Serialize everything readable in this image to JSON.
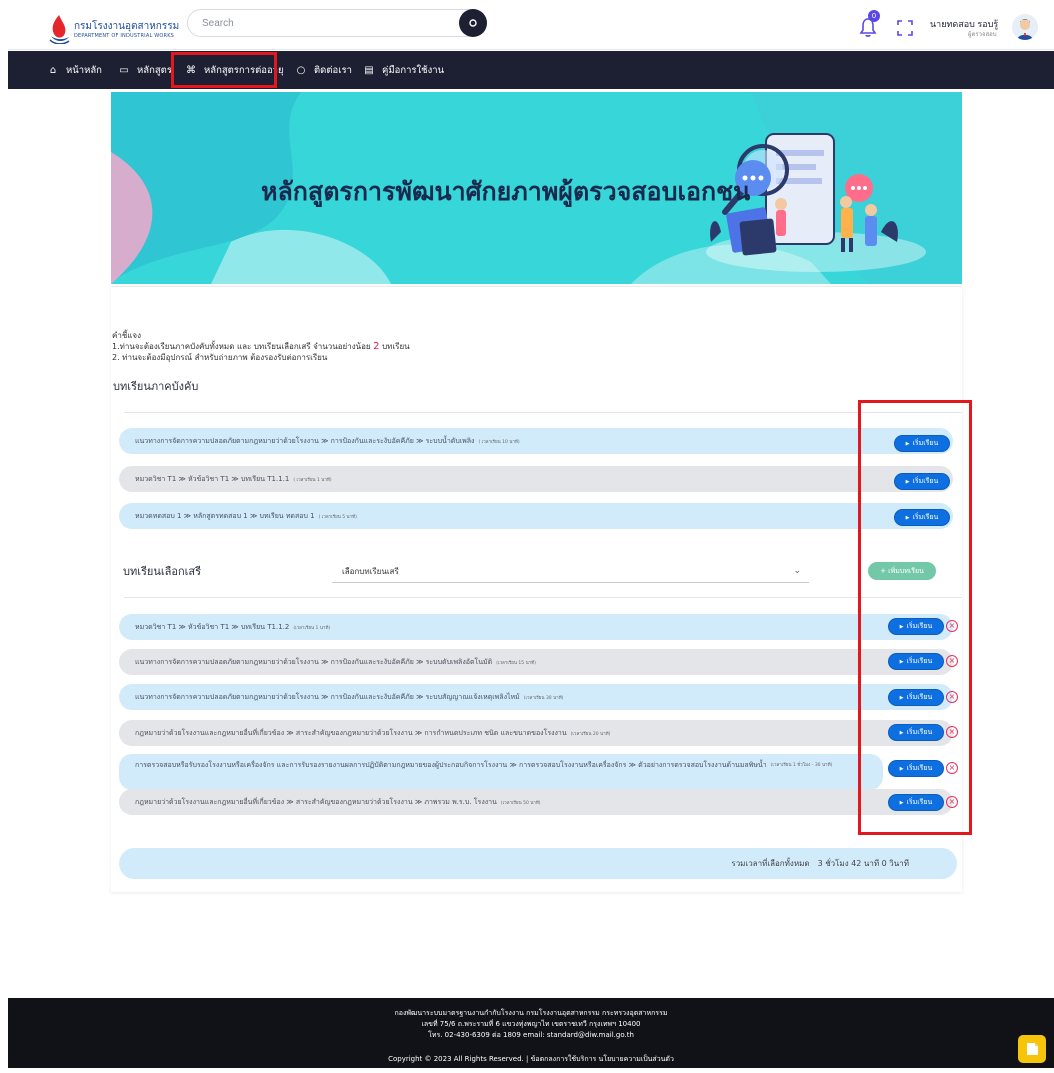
{
  "header": {
    "logo_th": "กรมโรงงานอุตสาหกรรม",
    "logo_en": "DEPARTMENT OF INDUSTRIAL WORKS",
    "search_placeholder": "Search",
    "notification_count": "0",
    "user_name": "นายทดสอบ รอบรู้",
    "user_role": "ผู้ตรวจสอบ"
  },
  "nav": {
    "items": [
      {
        "label": "หน้าหลัก",
        "icon": "home-icon"
      },
      {
        "label": "หลักสูตร",
        "icon": "monitor-icon"
      },
      {
        "label": "หลักสูตรการต่ออายุ",
        "icon": "command-icon"
      },
      {
        "label": "ติดต่อเรา",
        "icon": "chat-icon"
      },
      {
        "label": "คู่มือการใช้งาน",
        "icon": "book-icon"
      }
    ]
  },
  "hero": {
    "title": "หลักสูตรการพัฒนาศักยภาพผู้ตรวจสอบเอกชน"
  },
  "instructions": {
    "heading": "คำชี้แจง",
    "line1_a": "1.ท่านจะต้องเรียนภาคบังคับทั้งหมด และ บทเรียนเลือกเสรี จำนวนอย่างน้อย",
    "line1_count": "2",
    "line1_b": "บทเรียน",
    "line2": "2. ท่านจะต้องมีอุปกรณ์ สำหรับถ่ายภาพ ต้องรองรับต่อการเรียน"
  },
  "mandatory": {
    "title": "บทเรียนภาคบังคับ",
    "lessons": [
      {
        "path": "แนวทางการจัดการความปลอดภัยตามกฎหมายว่าด้วยโรงงาน ≫ การป้องกันและระงับอัคคีภัย ≫ ระบบน้ำดับเพลิง",
        "duration": "( เวลาเรียน 10 นาที)",
        "button": "เริ่มเรียน"
      },
      {
        "path": "หมวดวิชา T1 ≫ หัวข้อวิชา T1 ≫ บทเรียน T1.1.1",
        "duration": "( เวลาเรียน 1 นาที)",
        "button": "เริ่มเรียน"
      },
      {
        "path": "หมวดทดสอบ 1 ≫ หลักสูตรทดสอบ 1 ≫ บทเรียน ทดสอบ 1",
        "duration": "( เวลาเรียน 5 นาที)",
        "button": "เริ่มเรียน"
      }
    ]
  },
  "elective": {
    "title": "บทเรียนเลือกเสรี",
    "select_value": "เลือกบทเรียนเสรี",
    "add_button": "+ เพิ่มบทเรียน",
    "lessons": [
      {
        "path": "หมวดวิชา T1 ≫ หัวข้อวิชา T1 ≫ บทเรียน T1.1.2",
        "duration": "(เวลาเรียน 1 นาที)",
        "button": "เริ่มเรียน"
      },
      {
        "path": "แนวทางการจัดการความปลอดภัยตามกฎหมายว่าด้วยโรงงาน ≫ การป้องกันและระงับอัคคีภัย ≫ ระบบดับเพลิงอัตโนมัติ",
        "duration": "(เวลาเรียน 15 นาที)",
        "button": "เริ่มเรียน"
      },
      {
        "path": "แนวทางการจัดการความปลอดภัยตามกฎหมายว่าด้วยโรงงาน ≫ การป้องกันและระงับอัคคีภัย ≫ ระบบสัญญาณแจ้งเหตุเพลิงไหม้",
        "duration": "(เวลาเรียน 30 นาที)",
        "button": "เริ่มเรียน"
      },
      {
        "path": "กฎหมายว่าด้วยโรงงานและกฎหมายอื่นที่เกี่ยวข้อง ≫ สาระสำคัญของกฎหมายว่าด้วยโรงงาน ≫ การกำหนดประเภท ชนิด และขนาดของโรงงาน",
        "duration": "(เวลาเรียน 20 นาที)",
        "button": "เริ่มเรียน"
      },
      {
        "path": "การตรวจสอบหรือรับรองโรงงานหรือเครื่องจักร และการรับรองรายงานผลการปฏิบัติตามกฎหมายของผู้ประกอบกิจการโรงงาน ≫ การตรวจสอบโรงงานหรือเครื่องจักร ≫ ตัวอย่างการตรวจสอบโรงงานด้านมลพิษน้ำ",
        "duration": "(เวลาเรียน 1 ชั่วโมง - 30 นาที)",
        "button": "เริ่มเรียน"
      },
      {
        "path": "กฎหมายว่าด้วยโรงงานและกฎหมายอื่นที่เกี่ยวข้อง ≫ สาระสำคัญของกฎหมายว่าด้วยโรงงาน ≫ ภาพรวม พ.ร.บ. โรงงาน",
        "duration": "(เวลาเรียน 50 นาที)",
        "button": "เริ่มเรียน"
      }
    ]
  },
  "total": {
    "label": "รวมเวลาที่เลือกทั้งหมด",
    "value": "3 ชั่วโมง 42 นาที 0 วินาที"
  },
  "footer": {
    "line1": "กองพัฒนาระบบมาตรฐานงานกำกับโรงงาน กรมโรงงานอุตสาหกรรม กระทรวงอุตสาหกรรม",
    "line2": "เลขที่ 75/6 ถ.พระรามที่ 6 แขวงทุ่งพญาไท เขตราชเทวี กรุงเทพฯ 10400",
    "line3": "โทร. 02-430-6309 ต่อ 1809 email: standard@diw.mail.go.th",
    "copyright": "Copyright © 2023 All Rights Reserved. | ข้อตกลงการใช้บริการ นโยบายความเป็นส่วนตัว"
  },
  "colors": {
    "nav_bg": "#1d2033",
    "hero_bg": "#36d6d9",
    "row_blue": "#d2ebfb",
    "row_gray": "#e4e5e8",
    "start_button": "#0d6fe0",
    "add_button": "#73c8a8",
    "highlight": "#e3171e"
  }
}
